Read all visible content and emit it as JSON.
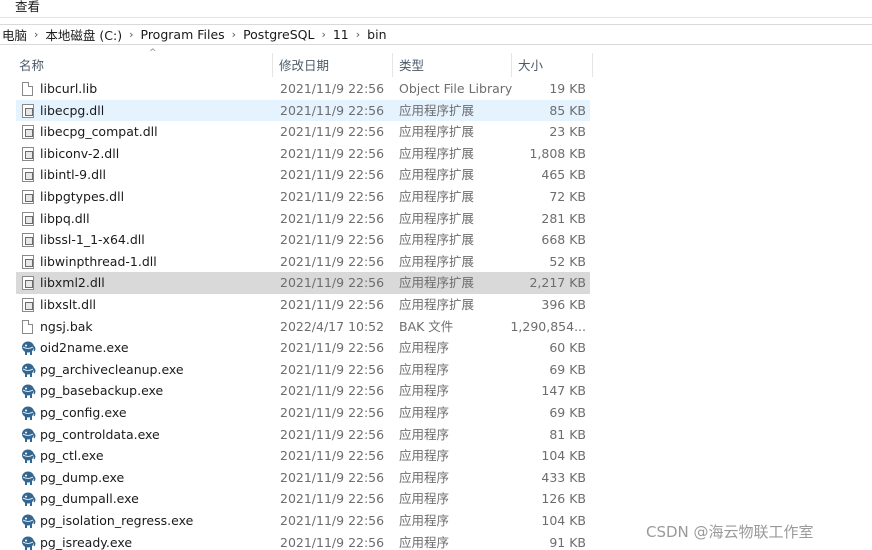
{
  "menubar": {
    "view_label": "查看"
  },
  "breadcrumb": {
    "items": [
      "电脑",
      "本地磁盘 (C:)",
      "Program Files",
      "PostgreSQL",
      "11",
      "bin"
    ],
    "separator": "›"
  },
  "columns": {
    "name": "名称",
    "date": "修改日期",
    "type": "类型",
    "size": "大小",
    "sort_indicator": "^"
  },
  "files": [
    {
      "name": "libcurl.lib",
      "date": "2021/11/9 22:56",
      "type": "Object File Library",
      "size": "19 KB",
      "icon": "file-icon"
    },
    {
      "name": "libecpg.dll",
      "date": "2021/11/9 22:56",
      "type": "应用程序扩展",
      "size": "85 KB",
      "icon": "dll-icon"
    },
    {
      "name": "libecpg_compat.dll",
      "date": "2021/11/9 22:56",
      "type": "应用程序扩展",
      "size": "23 KB",
      "icon": "dll-icon"
    },
    {
      "name": "libiconv-2.dll",
      "date": "2021/11/9 22:56",
      "type": "应用程序扩展",
      "size": "1,808 KB",
      "icon": "dll-icon"
    },
    {
      "name": "libintl-9.dll",
      "date": "2021/11/9 22:56",
      "type": "应用程序扩展",
      "size": "465 KB",
      "icon": "dll-icon"
    },
    {
      "name": "libpgtypes.dll",
      "date": "2021/11/9 22:56",
      "type": "应用程序扩展",
      "size": "72 KB",
      "icon": "dll-icon"
    },
    {
      "name": "libpq.dll",
      "date": "2021/11/9 22:56",
      "type": "应用程序扩展",
      "size": "281 KB",
      "icon": "dll-icon"
    },
    {
      "name": "libssl-1_1-x64.dll",
      "date": "2021/11/9 22:56",
      "type": "应用程序扩展",
      "size": "668 KB",
      "icon": "dll-icon"
    },
    {
      "name": "libwinpthread-1.dll",
      "date": "2021/11/9 22:56",
      "type": "应用程序扩展",
      "size": "52 KB",
      "icon": "dll-icon"
    },
    {
      "name": "libxml2.dll",
      "date": "2021/11/9 22:56",
      "type": "应用程序扩展",
      "size": "2,217 KB",
      "icon": "dll-icon"
    },
    {
      "name": "libxslt.dll",
      "date": "2021/11/9 22:56",
      "type": "应用程序扩展",
      "size": "396 KB",
      "icon": "dll-icon"
    },
    {
      "name": "ngsj.bak",
      "date": "2022/4/17 10:52",
      "type": "BAK 文件",
      "size": "1,290,854...",
      "icon": "file-icon"
    },
    {
      "name": "oid2name.exe",
      "date": "2021/11/9 22:56",
      "type": "应用程序",
      "size": "60 KB",
      "icon": "postgres-elephant-icon"
    },
    {
      "name": "pg_archivecleanup.exe",
      "date": "2021/11/9 22:56",
      "type": "应用程序",
      "size": "69 KB",
      "icon": "postgres-elephant-icon"
    },
    {
      "name": "pg_basebackup.exe",
      "date": "2021/11/9 22:56",
      "type": "应用程序",
      "size": "147 KB",
      "icon": "postgres-elephant-icon"
    },
    {
      "name": "pg_config.exe",
      "date": "2021/11/9 22:56",
      "type": "应用程序",
      "size": "69 KB",
      "icon": "postgres-elephant-icon"
    },
    {
      "name": "pg_controldata.exe",
      "date": "2021/11/9 22:56",
      "type": "应用程序",
      "size": "81 KB",
      "icon": "postgres-elephant-icon"
    },
    {
      "name": "pg_ctl.exe",
      "date": "2021/11/9 22:56",
      "type": "应用程序",
      "size": "104 KB",
      "icon": "postgres-elephant-icon"
    },
    {
      "name": "pg_dump.exe",
      "date": "2021/11/9 22:56",
      "type": "应用程序",
      "size": "433 KB",
      "icon": "postgres-elephant-icon"
    },
    {
      "name": "pg_dumpall.exe",
      "date": "2021/11/9 22:56",
      "type": "应用程序",
      "size": "126 KB",
      "icon": "postgres-elephant-icon"
    },
    {
      "name": "pg_isolation_regress.exe",
      "date": "2021/11/9 22:56",
      "type": "应用程序",
      "size": "104 KB",
      "icon": "postgres-elephant-icon"
    },
    {
      "name": "pg_isready.exe",
      "date": "2021/11/9 22:56",
      "type": "应用程序",
      "size": "91 KB",
      "icon": "postgres-elephant-icon"
    }
  ],
  "hover_row_index": 1,
  "selected_row_index": 9,
  "colors": {
    "hover": "#e5f3ff",
    "selected": "#d9d9d9",
    "postgres_blue": "#336791"
  },
  "watermark": "CSDN @海云物联工作室"
}
